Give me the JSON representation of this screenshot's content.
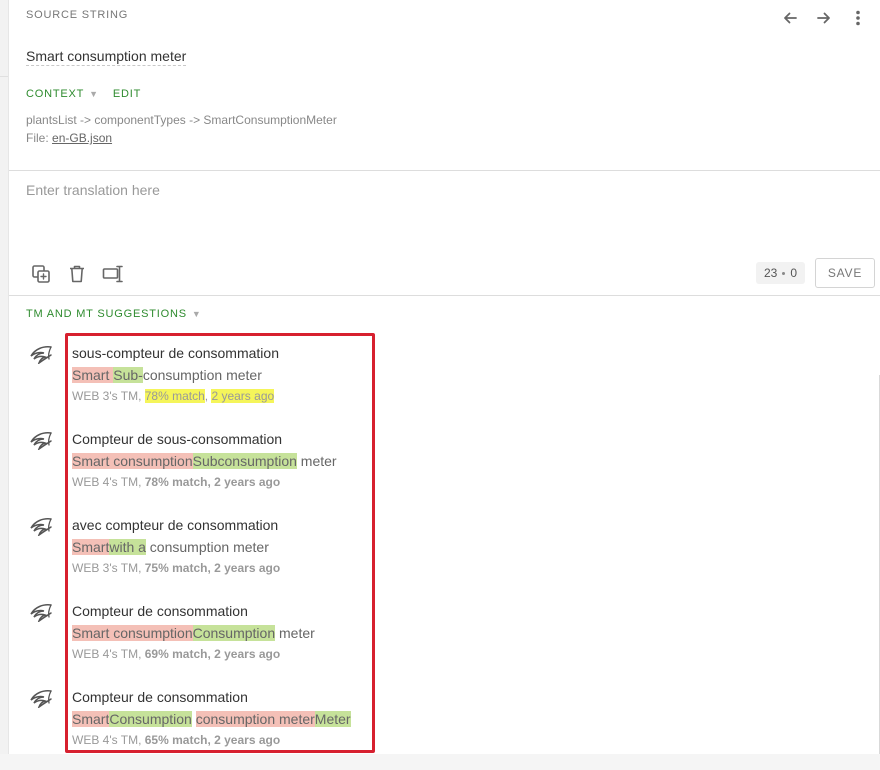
{
  "source": {
    "header": "SOURCE STRING",
    "text": "Smart consumption meter",
    "context_label": "CONTEXT",
    "edit_label": "EDIT",
    "context_path": "plantsList -> componentTypes -> SmartConsumptionMeter",
    "file_label": "File:",
    "file_name": "en-GB.json"
  },
  "nav": {
    "prev_icon": "arrow-left-icon",
    "next_icon": "arrow-right-icon",
    "more_icon": "more-vertical-icon"
  },
  "translation": {
    "placeholder": "Enter translation here"
  },
  "tools": {
    "copy_icon": "copy-source-icon",
    "delete_icon": "trash-icon",
    "transform_icon": "text-cursor-icon"
  },
  "counter": {
    "left": "23",
    "right": "0"
  },
  "save_label": "SAVE",
  "tm": {
    "header": "TM AND MT SUGGESTIONS",
    "suggestions": [
      {
        "target": "sous-compteur de consommation",
        "diff": [
          {
            "t": "Smart ",
            "k": "del"
          },
          {
            "t": "Sub-",
            "k": "ins"
          },
          {
            "t": "consumption meter",
            "k": ""
          }
        ],
        "meta": [
          {
            "t": "WEB 3's TM, ",
            "k": ""
          },
          {
            "t": "78% match",
            "k": "hl"
          },
          {
            "t": ", ",
            "k": ""
          },
          {
            "t": "2 years ago",
            "k": "hl"
          }
        ]
      },
      {
        "target": "Compteur de sous-consommation",
        "diff": [
          {
            "t": "Smart consumption",
            "k": "del"
          },
          {
            "t": "Subconsumption",
            "k": "ins"
          },
          {
            "t": " meter",
            "k": ""
          }
        ],
        "meta": [
          {
            "t": "WEB 4's TM, ",
            "k": ""
          },
          {
            "t": "78% match, 2 years ago",
            "k": "b"
          }
        ]
      },
      {
        "target": "avec compteur de consommation",
        "diff": [
          {
            "t": "Smart",
            "k": "del"
          },
          {
            "t": "with a",
            "k": "ins"
          },
          {
            "t": " consumption meter",
            "k": ""
          }
        ],
        "meta": [
          {
            "t": "WEB 3's TM, ",
            "k": ""
          },
          {
            "t": "75% match, 2 years ago",
            "k": "b"
          }
        ]
      },
      {
        "target": "Compteur de consommation",
        "diff": [
          {
            "t": "Smart consumption",
            "k": "del"
          },
          {
            "t": "Consumption",
            "k": "ins"
          },
          {
            "t": " meter",
            "k": ""
          }
        ],
        "meta": [
          {
            "t": "WEB 4's TM, ",
            "k": ""
          },
          {
            "t": "69% match, 2 years ago",
            "k": "b"
          }
        ]
      },
      {
        "target": "Compteur de consommation",
        "diff": [
          {
            "t": "Smart",
            "k": "del"
          },
          {
            "t": "Consumption",
            "k": "ins"
          },
          {
            "t": " ",
            "k": ""
          },
          {
            "t": "consumption meter",
            "k": "del"
          },
          {
            "t": "Meter",
            "k": "ins"
          }
        ],
        "meta": [
          {
            "t": "WEB 4's TM, ",
            "k": ""
          },
          {
            "t": "65% match, 2 years ago",
            "k": "b"
          }
        ]
      }
    ]
  }
}
